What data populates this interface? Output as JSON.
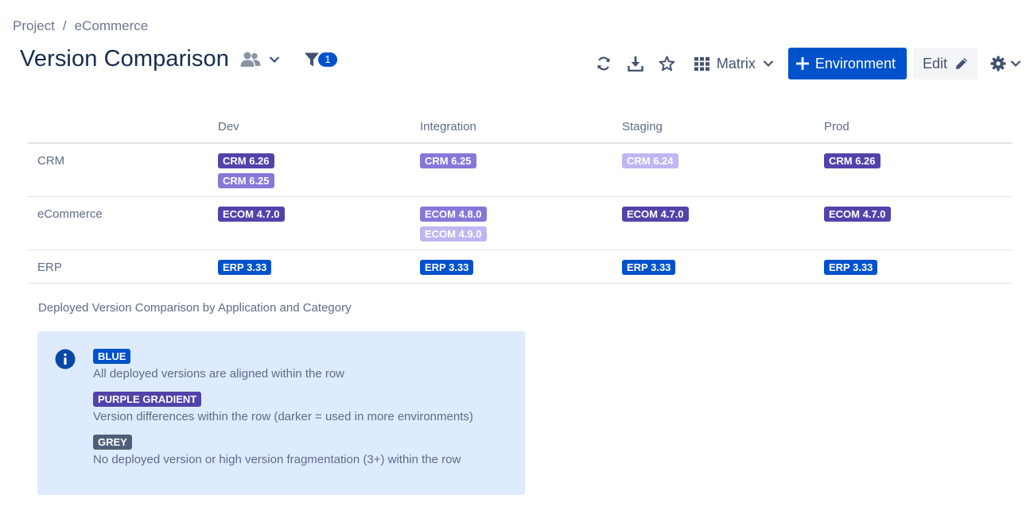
{
  "breadcrumb": {
    "items": [
      "Project",
      "eCommerce"
    ],
    "separator": "/"
  },
  "header": {
    "title": "Version Comparison",
    "filter_count": "1"
  },
  "toolbar": {
    "matrix_label": "Matrix",
    "environment_label": "Environment",
    "edit_label": "Edit",
    "icons": [
      "refresh-icon",
      "download-icon",
      "star-icon",
      "grid-icon",
      "plus-icon",
      "pencil-icon",
      "gear-icon"
    ]
  },
  "colors": {
    "blue": "#0052cc",
    "purple_dark": "#5243aa",
    "purple_mid": "#8777d9",
    "purple_light": "#c0b6f2",
    "grey": "#505f79",
    "info_bg": "#deebff"
  },
  "matrix": {
    "columns": [
      "",
      "Dev",
      "Integration",
      "Staging",
      "Prod"
    ],
    "rows": [
      {
        "label": "CRM",
        "cells": [
          [
            {
              "text": "CRM 6.26",
              "color": "purple_dark"
            },
            {
              "text": "CRM 6.25",
              "color": "purple_mid"
            }
          ],
          [
            {
              "text": "CRM 6.25",
              "color": "purple_mid"
            }
          ],
          [
            {
              "text": "CRM 6.24",
              "color": "purple_light"
            }
          ],
          [
            {
              "text": "CRM 6.26",
              "color": "purple_dark"
            }
          ]
        ]
      },
      {
        "label": "eCommerce",
        "cells": [
          [
            {
              "text": "ECOM 4.7.0",
              "color": "purple_dark"
            }
          ],
          [
            {
              "text": "ECOM 4.8.0",
              "color": "purple_mid"
            },
            {
              "text": "ECOM 4.9.0",
              "color": "purple_light"
            }
          ],
          [
            {
              "text": "ECOM 4.7.0",
              "color": "purple_dark"
            }
          ],
          [
            {
              "text": "ECOM 4.7.0",
              "color": "purple_dark"
            }
          ]
        ]
      },
      {
        "label": "ERP",
        "cells": [
          [
            {
              "text": "ERP 3.33",
              "color": "blue"
            }
          ],
          [
            {
              "text": "ERP 3.33",
              "color": "blue"
            }
          ],
          [
            {
              "text": "ERP 3.33",
              "color": "blue"
            }
          ],
          [
            {
              "text": "ERP 3.33",
              "color": "blue"
            }
          ]
        ]
      }
    ]
  },
  "caption": "Deployed Version Comparison by Application and Category",
  "legend": {
    "icon": "info-icon",
    "items": [
      {
        "label": "BLUE",
        "color": "blue",
        "description": "All deployed versions are aligned within the row"
      },
      {
        "label": "PURPLE GRADIENT",
        "color": "purple_dark",
        "description": "Version differences within the row (darker = used in more environments)"
      },
      {
        "label": "GREY",
        "color": "grey",
        "description": "No deployed version or high version fragmentation (3+) within the row"
      }
    ]
  }
}
